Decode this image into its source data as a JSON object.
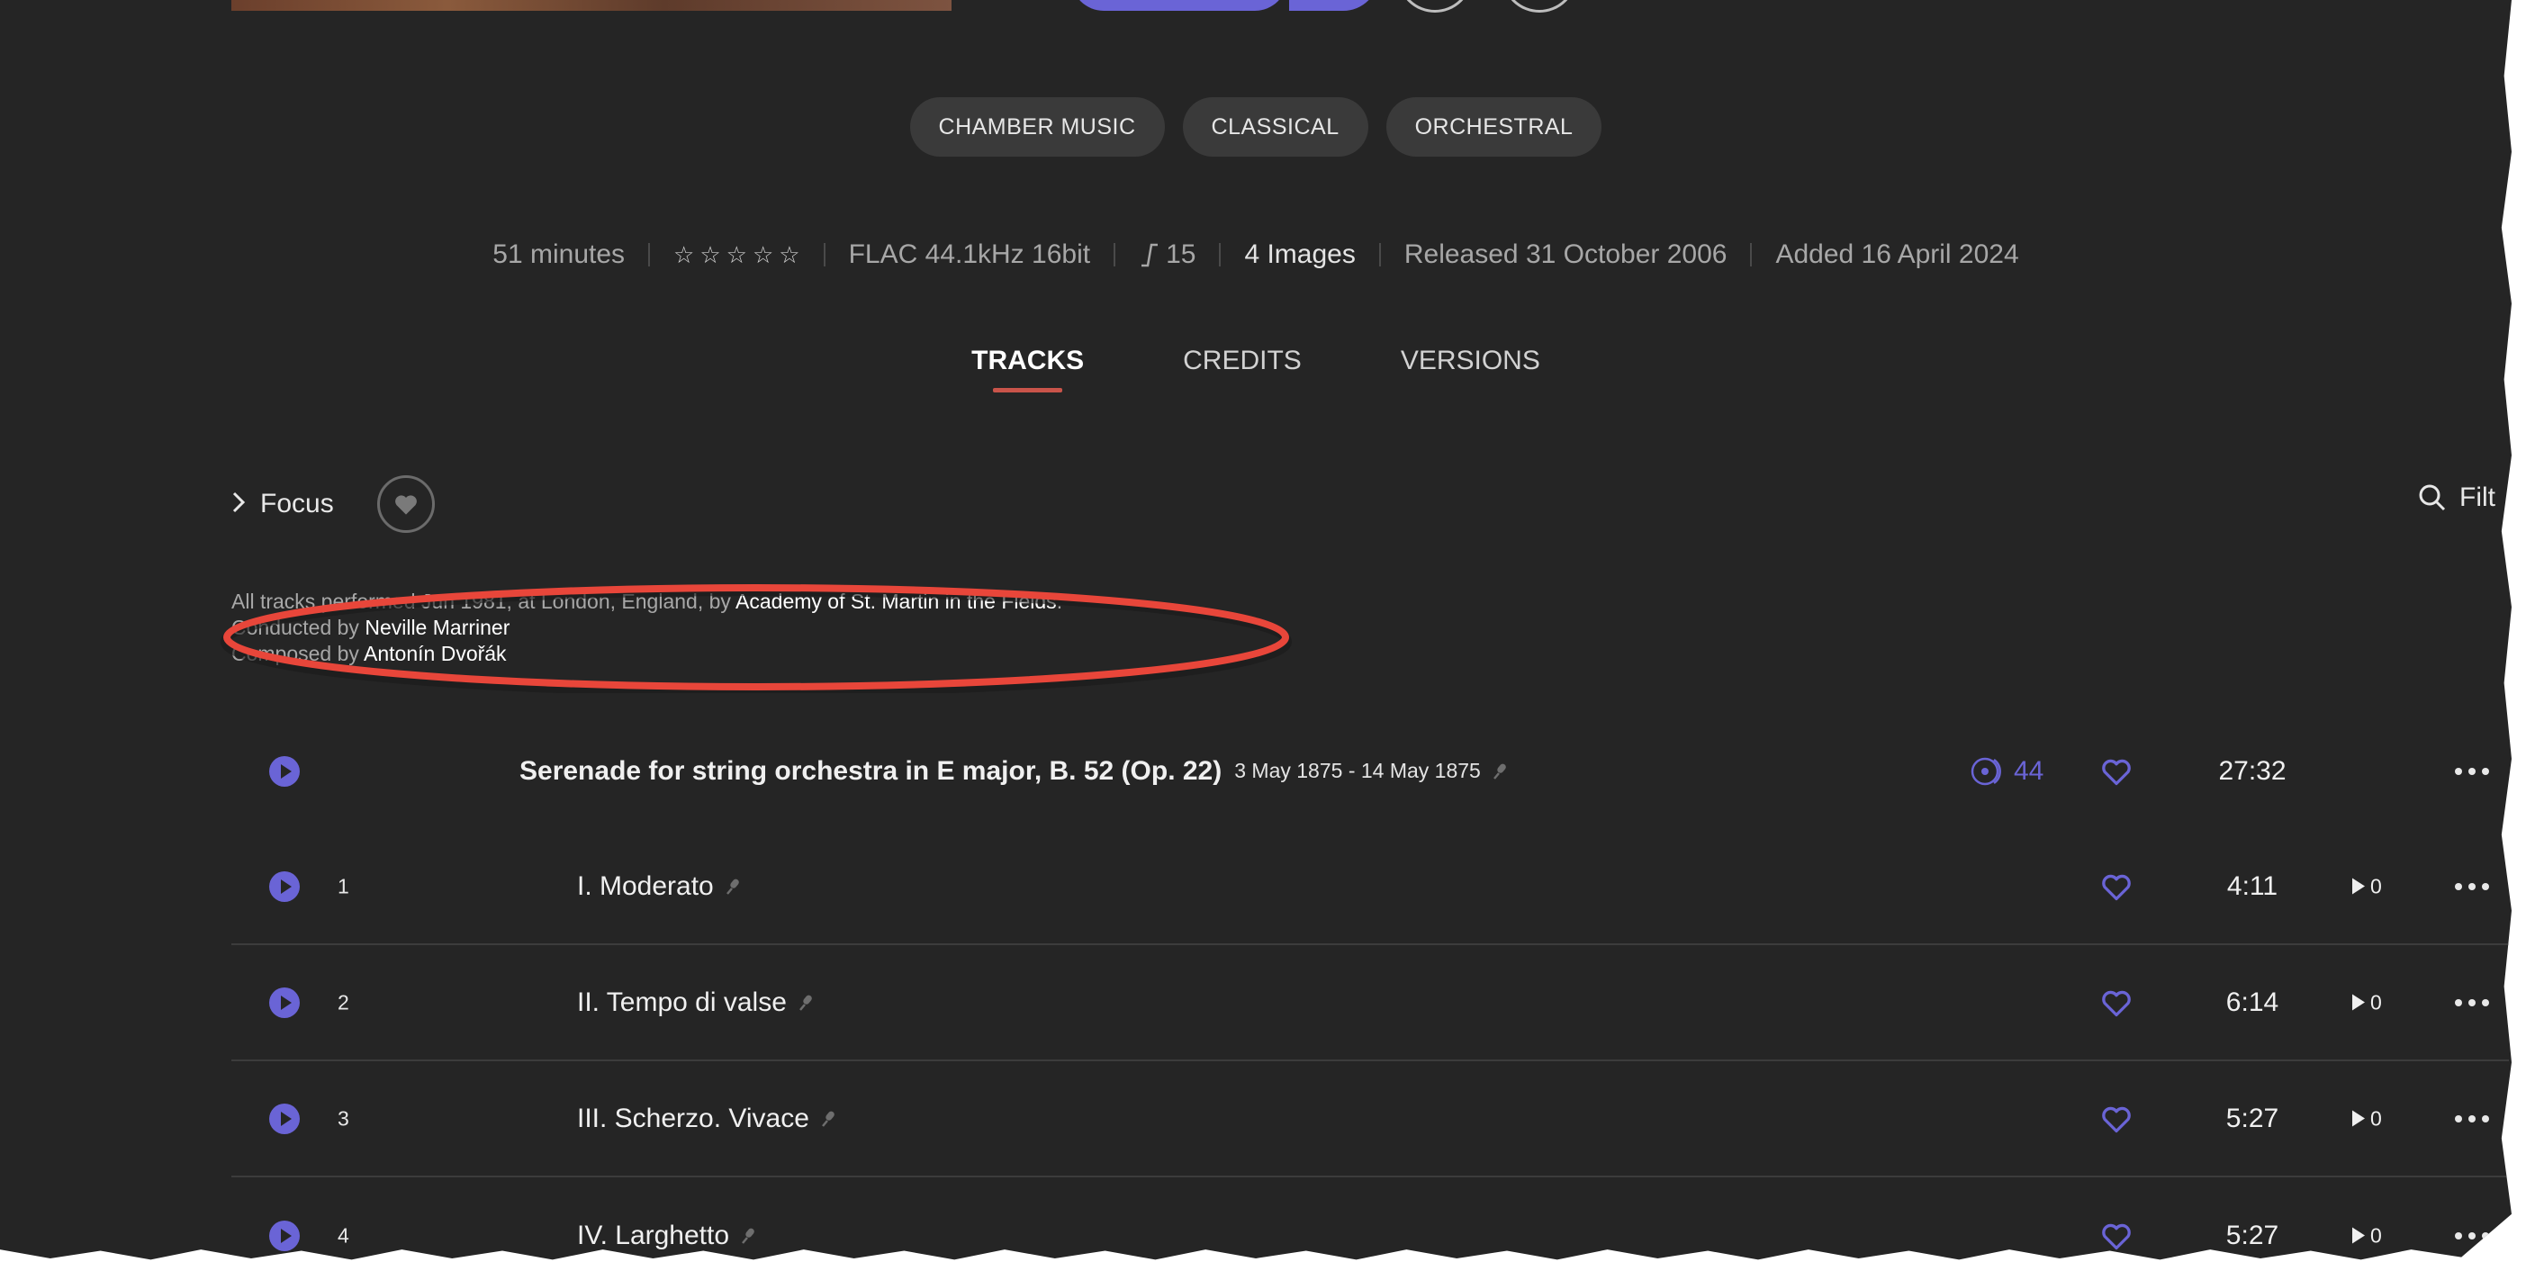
{
  "genres": [
    "CHAMBER MUSIC",
    "CLASSICAL",
    "ORCHESTRAL"
  ],
  "meta": {
    "duration": "51 minutes",
    "rating_stars": 0,
    "format": "FLAC 44.1kHz 16bit",
    "loudness": "15",
    "images": "4 Images",
    "released": "Released 31 October 2006",
    "added": "Added 16 April 2024"
  },
  "tabs": [
    {
      "label": "TRACKS",
      "active": true
    },
    {
      "label": "CREDITS",
      "active": false
    },
    {
      "label": "VERSIONS",
      "active": false
    }
  ],
  "focus_label": "Focus",
  "filter_label": "Filt",
  "performance": {
    "line1_prefix": "All tracks performed Jun 1981, at London, England, by ",
    "line1_link": "Academy of St. Martin in the Fields",
    "line1_suffix": ".",
    "line2_prefix": "Conducted by ",
    "line2_link": "Neville Marriner",
    "line3_prefix": "Composed by ",
    "line3_link": "Antonín Dvořák"
  },
  "work": {
    "title": "Serenade for string orchestra in E major, B. 52 (Op. 22)",
    "dates": "3 May 1875 - 14 May 1875",
    "listeners": "44",
    "duration": "27:32"
  },
  "tracks": [
    {
      "num": "1",
      "title": "I. Moderato",
      "duration": "4:11",
      "plays": "0"
    },
    {
      "num": "2",
      "title": "II. Tempo di valse",
      "duration": "6:14",
      "plays": "0"
    },
    {
      "num": "3",
      "title": "III. Scherzo. Vivace",
      "duration": "5:27",
      "plays": "0"
    },
    {
      "num": "4",
      "title": "IV. Larghetto",
      "duration": "5:27",
      "plays": "0"
    }
  ],
  "colors": {
    "background": "#252525",
    "accent": "#6a64d6",
    "tab_underline": "#c9544a",
    "annotation": "#e8463a"
  },
  "icons": {
    "play": "play-circle-icon",
    "heart": "heart-icon",
    "microphone": "microphone-icon",
    "more": "more-horizontal-icon",
    "search": "search-icon",
    "chevron": "chevron-right-icon",
    "listeners": "vinyl-disc-icon"
  }
}
